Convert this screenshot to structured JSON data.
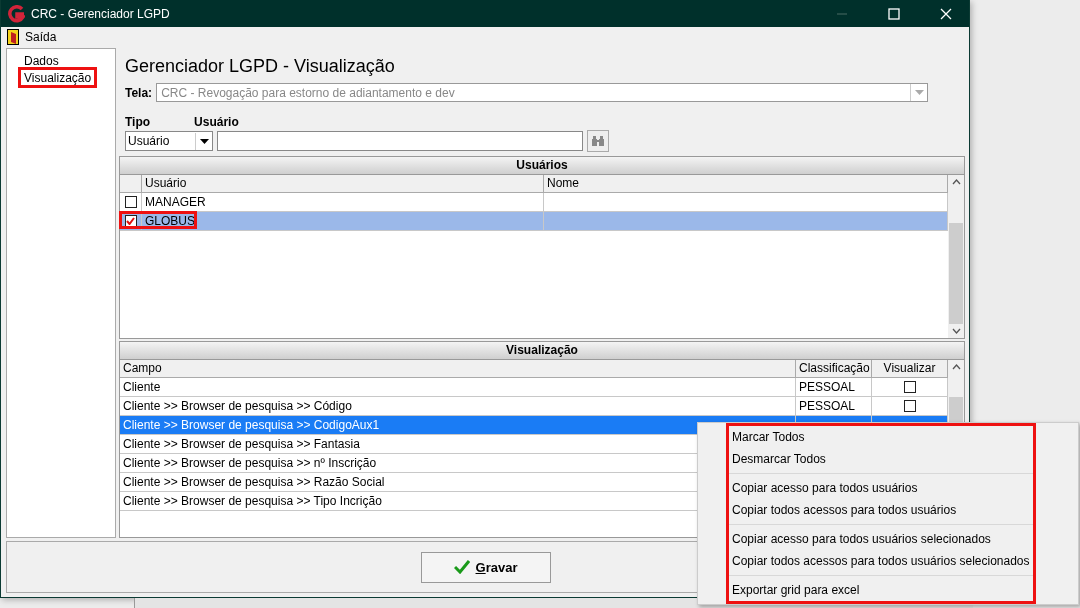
{
  "window": {
    "title": "CRC - Gerenciador LGPD"
  },
  "menu": [
    {
      "label": "Saída"
    }
  ],
  "tree": [
    {
      "label": "Dados",
      "annotated": false
    },
    {
      "label": "Visualização",
      "annotated": true
    }
  ],
  "heading": "Gerenciador LGPD - Visualização",
  "tela": {
    "label": "Tela:",
    "value": "CRC - Revogação para estorno de adiantamento e dev",
    "disabled": true
  },
  "tipo": {
    "label": "Tipo",
    "value": "Usuário"
  },
  "usuario": {
    "label": "Usuário"
  },
  "users_grid": {
    "caption": "Usuários",
    "columns": [
      "Usuário",
      "Nome"
    ],
    "rows": [
      {
        "usuario": "MANAGER",
        "checked": false,
        "selected": false,
        "annotated": false
      },
      {
        "usuario": "GLOBUS",
        "checked": true,
        "selected": true,
        "annotated": true
      }
    ]
  },
  "view_grid": {
    "caption": "Visualização",
    "columns": [
      "Campo",
      "Classificação",
      "Visualizar"
    ],
    "rows": [
      {
        "campo": "Cliente",
        "classificacao": "PESSOAL",
        "visualizar": false,
        "selected": false
      },
      {
        "campo": "Cliente >> Browser de pesquisa >> Código",
        "classificacao": "PESSOAL",
        "visualizar": false,
        "selected": false
      },
      {
        "campo": "Cliente >> Browser de pesquisa >> CodigoAux1",
        "selected": true
      },
      {
        "campo": "Cliente >> Browser de pesquisa >> Fantasia",
        "selected": false
      },
      {
        "campo": "Cliente >> Browser de pesquisa >> nº Inscrição",
        "selected": false
      },
      {
        "campo": "Cliente >> Browser de pesquisa >> Razão Social",
        "selected": false
      },
      {
        "campo": "Cliente >> Browser de pesquisa >> Tipo Incrição",
        "selected": false
      }
    ]
  },
  "save_button": {
    "label": "Gravar"
  },
  "context_menu": {
    "annotated": true,
    "items": [
      {
        "kind": "item",
        "label": "Marcar Todos"
      },
      {
        "kind": "item",
        "label": "Desmarcar Todos"
      },
      {
        "kind": "separator"
      },
      {
        "kind": "item",
        "label": "Copiar acesso para todos usuários"
      },
      {
        "kind": "item",
        "label": "Copiar todos acessos para todos usuários"
      },
      {
        "kind": "separator"
      },
      {
        "kind": "item",
        "label": "Copiar acesso para todos usuários selecionados"
      },
      {
        "kind": "item",
        "label": "Copiar todos acessos para todos usuários selecionados"
      },
      {
        "kind": "separator"
      },
      {
        "kind": "item",
        "label": "Exportar grid para excel"
      }
    ]
  }
}
